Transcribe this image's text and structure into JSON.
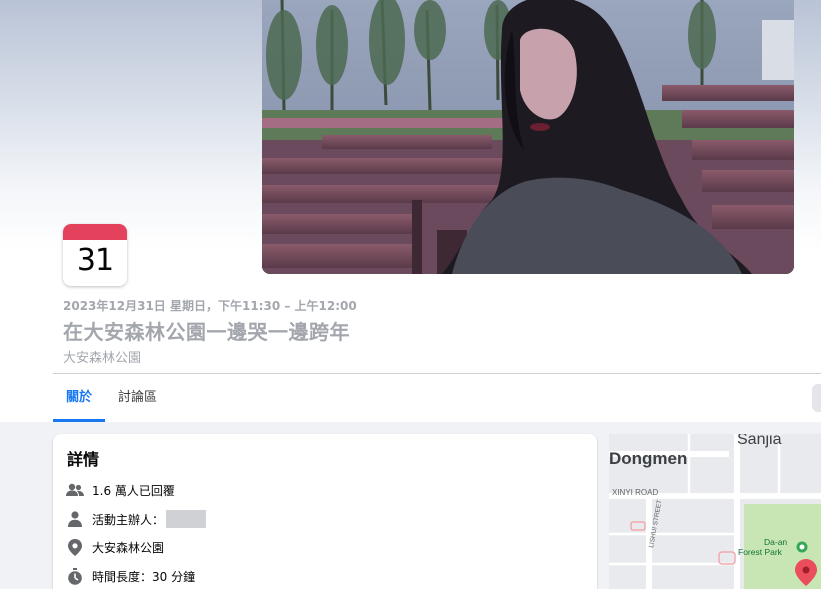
{
  "event": {
    "date_badge": "31日",
    "when": "2023年12月31日 星期日，下午11:30 – 上午12:00",
    "title": "在大安森林公園一邊哭一邊跨年",
    "location": "大安森林公園"
  },
  "tabs": [
    {
      "label": "關於",
      "active": true
    },
    {
      "label": "討論區",
      "active": false
    }
  ],
  "details": {
    "title": "詳情",
    "rows": [
      {
        "icon": "people-icon",
        "text": "1.6 萬人已回覆"
      },
      {
        "icon": "person-icon",
        "text": "活動主辦人："
      },
      {
        "icon": "location-pin-icon",
        "text": "大安森林公園"
      },
      {
        "icon": "stopwatch-icon",
        "text": "時間長度：30 分鐘"
      }
    ]
  },
  "map": {
    "labels": {
      "sanjia": "Sanjia",
      "dongmen": "Dongmen",
      "xinyi": "XINYI ROAD",
      "lishui": "LISHUI STREET",
      "park": "Da-an Forest Park"
    }
  },
  "colors": {
    "accent": "#1877f2",
    "badge_red": "#e4415c",
    "muted_text": "#a3a7ad",
    "park_green": "#c8e6b4",
    "pin_red": "#ea4d5b"
  }
}
